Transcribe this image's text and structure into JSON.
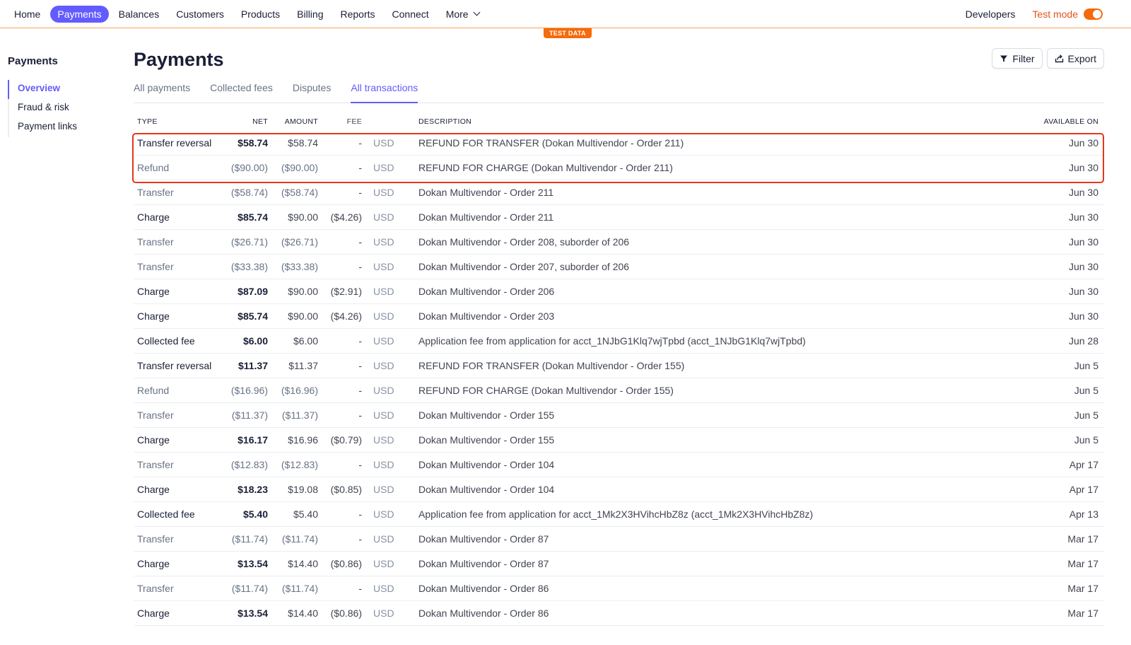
{
  "nav": {
    "items": [
      {
        "label": "Home",
        "active": false
      },
      {
        "label": "Payments",
        "active": true
      },
      {
        "label": "Balances",
        "active": false
      },
      {
        "label": "Customers",
        "active": false
      },
      {
        "label": "Products",
        "active": false
      },
      {
        "label": "Billing",
        "active": false
      },
      {
        "label": "Reports",
        "active": false
      },
      {
        "label": "Connect",
        "active": false
      }
    ],
    "more_label": "More",
    "developers_label": "Developers",
    "test_mode_label": "Test mode",
    "test_mode_on": true,
    "test_data_badge": "TEST DATA"
  },
  "sidebar": {
    "title": "Payments",
    "items": [
      {
        "label": "Overview",
        "active": true
      },
      {
        "label": "Fraud & risk",
        "active": false
      },
      {
        "label": "Payment links",
        "active": false
      }
    ]
  },
  "main": {
    "title": "Payments",
    "filter_label": "Filter",
    "export_label": "Export",
    "tabs": [
      {
        "label": "All payments",
        "active": false
      },
      {
        "label": "Collected fees",
        "active": false
      },
      {
        "label": "Disputes",
        "active": false
      },
      {
        "label": "All transactions",
        "active": true
      }
    ]
  },
  "table": {
    "headers": {
      "type": "TYPE",
      "net": "NET",
      "amount": "AMOUNT",
      "fee": "FEE",
      "currency": "",
      "description": "DESCRIPTION",
      "available_on": "AVAILABLE ON"
    },
    "highlighted_rows": [
      0,
      1
    ],
    "rows": [
      {
        "type": "Transfer reversal",
        "net": "$58.74",
        "amount": "$58.74",
        "fee": "-",
        "currency": "USD",
        "description": "REFUND FOR TRANSFER (Dokan Multivendor - Order 211)",
        "available_on": "Jun 30",
        "tone": "pos"
      },
      {
        "type": "Refund",
        "net": "($90.00)",
        "amount": "($90.00)",
        "fee": "-",
        "currency": "USD",
        "description": "REFUND FOR CHARGE (Dokan Multivendor - Order 211)",
        "available_on": "Jun 30",
        "tone": "neg"
      },
      {
        "type": "Transfer",
        "net": "($58.74)",
        "amount": "($58.74)",
        "fee": "-",
        "currency": "USD",
        "description": "Dokan Multivendor - Order 211",
        "available_on": "Jun 30",
        "tone": "neg"
      },
      {
        "type": "Charge",
        "net": "$85.74",
        "amount": "$90.00",
        "fee": "($4.26)",
        "currency": "USD",
        "description": "Dokan Multivendor - Order 211",
        "available_on": "Jun 30",
        "tone": "pos"
      },
      {
        "type": "Transfer",
        "net": "($26.71)",
        "amount": "($26.71)",
        "fee": "-",
        "currency": "USD",
        "description": "Dokan Multivendor - Order 208, suborder of 206",
        "available_on": "Jun 30",
        "tone": "neg"
      },
      {
        "type": "Transfer",
        "net": "($33.38)",
        "amount": "($33.38)",
        "fee": "-",
        "currency": "USD",
        "description": "Dokan Multivendor - Order 207, suborder of 206",
        "available_on": "Jun 30",
        "tone": "neg"
      },
      {
        "type": "Charge",
        "net": "$87.09",
        "amount": "$90.00",
        "fee": "($2.91)",
        "currency": "USD",
        "description": "Dokan Multivendor - Order 206",
        "available_on": "Jun 30",
        "tone": "pos"
      },
      {
        "type": "Charge",
        "net": "$85.74",
        "amount": "$90.00",
        "fee": "($4.26)",
        "currency": "USD",
        "description": "Dokan Multivendor - Order 203",
        "available_on": "Jun 30",
        "tone": "pos"
      },
      {
        "type": "Collected fee",
        "net": "$6.00",
        "amount": "$6.00",
        "fee": "-",
        "currency": "USD",
        "description": "Application fee from application for acct_1NJbG1Klq7wjTpbd (acct_1NJbG1Klq7wjTpbd)",
        "available_on": "Jun 28",
        "tone": "pos"
      },
      {
        "type": "Transfer reversal",
        "net": "$11.37",
        "amount": "$11.37",
        "fee": "-",
        "currency": "USD",
        "description": "REFUND FOR TRANSFER (Dokan Multivendor - Order 155)",
        "available_on": "Jun 5",
        "tone": "pos"
      },
      {
        "type": "Refund",
        "net": "($16.96)",
        "amount": "($16.96)",
        "fee": "-",
        "currency": "USD",
        "description": "REFUND FOR CHARGE (Dokan Multivendor - Order 155)",
        "available_on": "Jun 5",
        "tone": "neg"
      },
      {
        "type": "Transfer",
        "net": "($11.37)",
        "amount": "($11.37)",
        "fee": "-",
        "currency": "USD",
        "description": "Dokan Multivendor - Order 155",
        "available_on": "Jun 5",
        "tone": "neg"
      },
      {
        "type": "Charge",
        "net": "$16.17",
        "amount": "$16.96",
        "fee": "($0.79)",
        "currency": "USD",
        "description": "Dokan Multivendor - Order 155",
        "available_on": "Jun 5",
        "tone": "pos"
      },
      {
        "type": "Transfer",
        "net": "($12.83)",
        "amount": "($12.83)",
        "fee": "-",
        "currency": "USD",
        "description": "Dokan Multivendor - Order 104",
        "available_on": "Apr 17",
        "tone": "neg"
      },
      {
        "type": "Charge",
        "net": "$18.23",
        "amount": "$19.08",
        "fee": "($0.85)",
        "currency": "USD",
        "description": "Dokan Multivendor - Order 104",
        "available_on": "Apr 17",
        "tone": "pos"
      },
      {
        "type": "Collected fee",
        "net": "$5.40",
        "amount": "$5.40",
        "fee": "-",
        "currency": "USD",
        "description": "Application fee from application for acct_1Mk2X3HVihcHbZ8z (acct_1Mk2X3HVihcHbZ8z)",
        "available_on": "Apr 13",
        "tone": "pos"
      },
      {
        "type": "Transfer",
        "net": "($11.74)",
        "amount": "($11.74)",
        "fee": "-",
        "currency": "USD",
        "description": "Dokan Multivendor - Order 87",
        "available_on": "Mar 17",
        "tone": "neg"
      },
      {
        "type": "Charge",
        "net": "$13.54",
        "amount": "$14.40",
        "fee": "($0.86)",
        "currency": "USD",
        "description": "Dokan Multivendor - Order 87",
        "available_on": "Mar 17",
        "tone": "pos"
      },
      {
        "type": "Transfer",
        "net": "($11.74)",
        "amount": "($11.74)",
        "fee": "-",
        "currency": "USD",
        "description": "Dokan Multivendor - Order 86",
        "available_on": "Mar 17",
        "tone": "neg"
      },
      {
        "type": "Charge",
        "net": "$13.54",
        "amount": "$14.40",
        "fee": "($0.86)",
        "currency": "USD",
        "description": "Dokan Multivendor - Order 86",
        "available_on": "Mar 17",
        "tone": "pos"
      }
    ]
  },
  "colors": {
    "accent": "#635bff",
    "test_mode": "#f56a0a",
    "highlight_border": "#e5361a"
  }
}
